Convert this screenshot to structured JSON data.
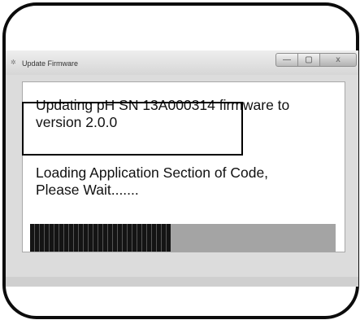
{
  "window": {
    "title": "Update Firmware",
    "icon": "app-icon",
    "controls": {
      "minimize_glyph": "—",
      "maximize_glyph": "▢",
      "close_glyph": "x"
    }
  },
  "dialog": {
    "update_line_1": "Updating pH SN 13A000314 firmware to",
    "update_line_2": "version 2.0.0",
    "status_line_1": "Loading Application Section of Code,",
    "status_line_2": "Please Wait......."
  },
  "progress": {
    "fraction": 0.46
  }
}
